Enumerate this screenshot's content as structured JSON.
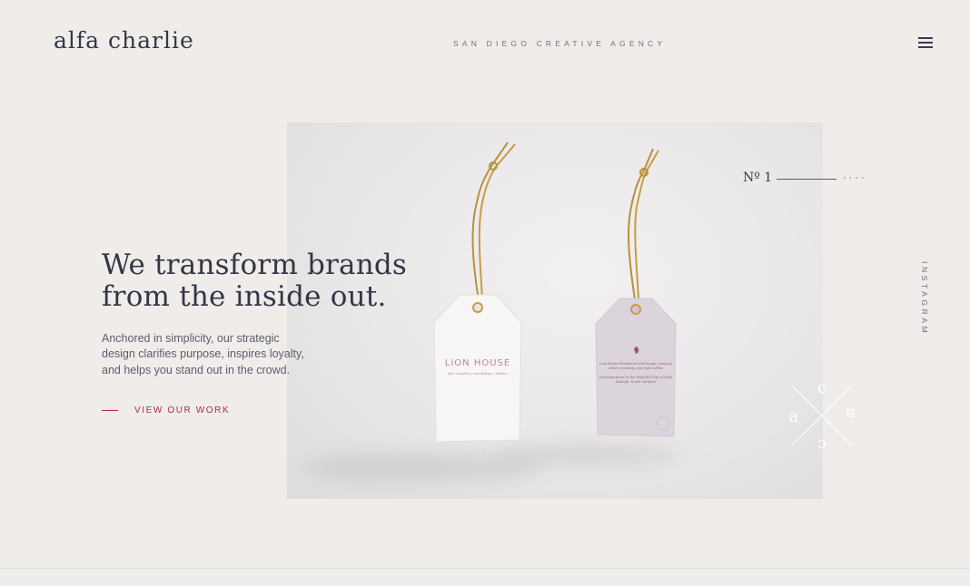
{
  "header": {
    "logo": "alfa charlie",
    "tagline": "SAN DIEGO CREATIVE AGENCY",
    "menu_icon": "hamburger-menu-icon"
  },
  "hero": {
    "headline": "We transform brands from the inside out.",
    "intro": "Anchored in simplicity, our strategic design clarifies purpose, inspires loyalty, and helps you stand out in the crowd.",
    "cta_label": "VIEW OUR WORK",
    "accent_color": "#b3294e"
  },
  "slide": {
    "number": "Nº 1",
    "dots": "····",
    "tag_front": {
      "title": "LION HOUSE",
      "subtitle": "fine wooden / workshop / atelier"
    },
    "tag_back": {
      "line1": "Lion House Woodwork and design company",
      "line2": "where creativity and style collide",
      "line3": "Headquartered in the beautiful City of Oaks",
      "line4": "Raleigh, North Carolina"
    },
    "monogram_letters": [
      "a",
      "c",
      "a",
      "c"
    ]
  },
  "social": {
    "instagram": "INSTAGRAM"
  }
}
